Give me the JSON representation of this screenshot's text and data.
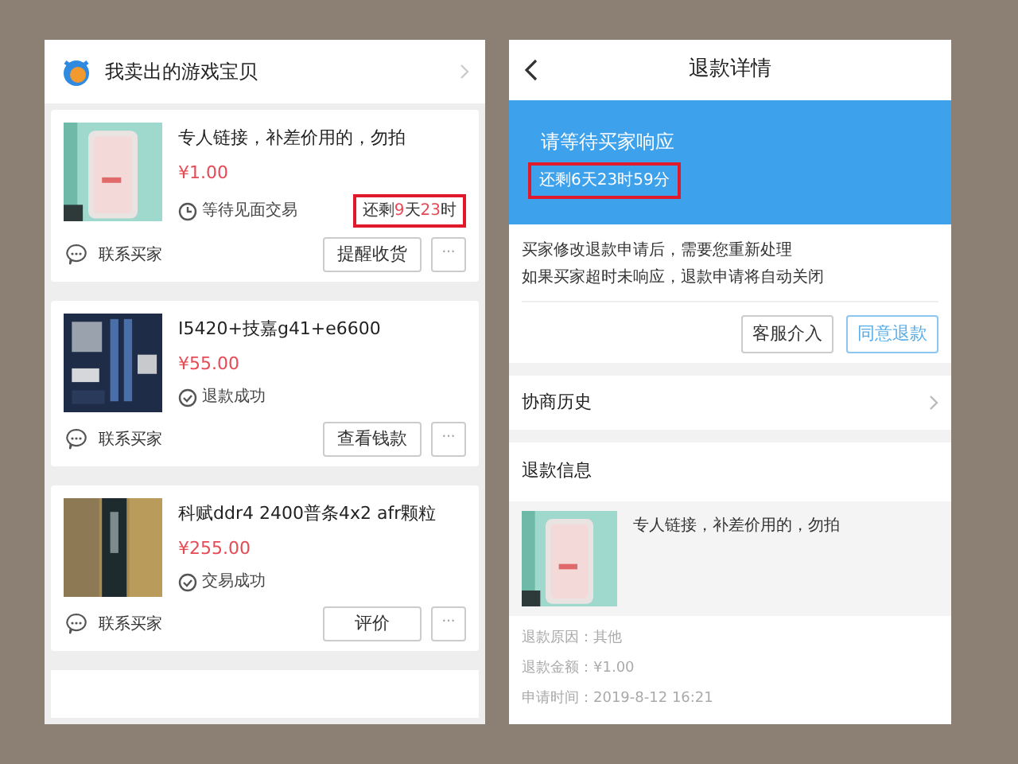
{
  "left": {
    "header": {
      "title": "我卖出的游戏宝贝"
    },
    "cards": [
      {
        "picture": {
          "kind": "case"
        },
        "title": "专人链接，补差价用的，勿拍",
        "price": "¥1.00",
        "status": {
          "kind": "clock",
          "text": "等待见面交易"
        },
        "countdown": [
          {
            "text": "还剩",
            "highlight": false
          },
          {
            "text": "9",
            "highlight": true
          },
          {
            "text": "天",
            "highlight": false
          },
          {
            "text": "23",
            "highlight": true
          },
          {
            "text": "时",
            "highlight": false
          }
        ],
        "contact": "联系买家",
        "action": "提醒收货",
        "more": "···"
      },
      {
        "picture": {
          "kind": "board"
        },
        "title": "I5420+技嘉g41+e6600",
        "price": "¥55.00",
        "status": {
          "kind": "check",
          "text": "退款成功"
        },
        "contact": "联系买家",
        "action": "查看钱款",
        "more": "···"
      },
      {
        "picture": {
          "kind": "ram"
        },
        "title": "科赋ddr4 2400普条4x2 afr颗粒",
        "price": "¥255.00",
        "status": {
          "kind": "check",
          "text": "交易成功"
        },
        "contact": "联系买家",
        "action": "评价",
        "more": "···"
      }
    ]
  },
  "right": {
    "nav": {
      "title": "退款详情"
    },
    "banner": {
      "message": "请等待买家响应",
      "countdown": "还剩6天23时59分"
    },
    "notice": [
      "买家修改退款申请后，需要您重新处理",
      "如果买家超时未响应，退款申请将自动关闭"
    ],
    "buttons": [
      {
        "label": "客服介入",
        "kind": "default"
      },
      {
        "label": "同意退款",
        "kind": "primary"
      }
    ],
    "history": {
      "label": "协商历史"
    },
    "refund_info": {
      "heading": "退款信息",
      "product_title": "专人链接，补差价用的，勿拍",
      "details": [
        {
          "label": "退款原因：",
          "value": "其他"
        },
        {
          "label": "退款金额：",
          "value": "¥1.00"
        },
        {
          "label": "申请时间：",
          "value": "2019-8-12 16:21"
        }
      ]
    }
  }
}
